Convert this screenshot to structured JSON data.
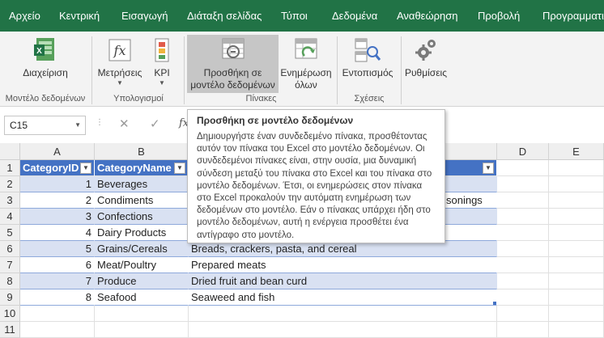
{
  "tabs": [
    "Αρχείο",
    "Κεντρική",
    "Εισαγωγή",
    "Διάταξη σελίδας",
    "Τύποι",
    "Δεδομένα",
    "Αναθεώρηση",
    "Προβολή",
    "Προγραμματισ"
  ],
  "ribbon": {
    "manage_label": "Διαχείριση",
    "measures_label": "Μετρήσεις",
    "kpi_label": "KPI",
    "add_line1": "Προσθήκη σε",
    "add_line2": "μοντέλο δεδομένων",
    "update_line1": "Ενημέρωση",
    "update_line2": "όλων",
    "detect_label": "Εντοπισμός",
    "settings_label": "Ρυθμίσεις",
    "group_model": "Μοντέλο δεδομένων",
    "group_calc": "Υπολογισμοί",
    "group_tables": "Πίνακες",
    "group_relations": "Σχέσεις"
  },
  "formula_bar": {
    "name_box": "C15",
    "fx": "fx"
  },
  "grid": {
    "columns": [
      "A",
      "B",
      "C",
      "D",
      "E"
    ],
    "rows": [
      "1",
      "2",
      "3",
      "4",
      "5",
      "6",
      "7",
      "8",
      "9",
      "10",
      "11"
    ],
    "headers": [
      "CategoryID",
      "CategoryName",
      "Description"
    ],
    "data": [
      {
        "id": "1",
        "name": "Beverages",
        "desc": ""
      },
      {
        "id": "2",
        "name": "Condiments",
        "desc": "",
        "overflow": "sonings"
      },
      {
        "id": "3",
        "name": "Confections",
        "desc": ""
      },
      {
        "id": "4",
        "name": "Dairy Products",
        "desc": ""
      },
      {
        "id": "5",
        "name": "Grains/Cereals",
        "desc": "Breads, crackers, pasta, and cereal"
      },
      {
        "id": "6",
        "name": "Meat/Poultry",
        "desc": "Prepared meats"
      },
      {
        "id": "7",
        "name": "Produce",
        "desc": "Dried fruit and bean curd"
      },
      {
        "id": "8",
        "name": "Seafood",
        "desc": "Seaweed and fish"
      }
    ]
  },
  "tooltip": {
    "title": "Προσθήκη σε μοντέλο δεδομένων",
    "body": "Δημιουργήστε έναν συνδεδεμένο πίνακα, προσθέτοντας αυτόν τον πίνακα του Excel στο μοντέλο δεδομένων. Οι συνδεδεμένοι πίνακες είναι, στην ουσία, μια δυναμική σύνδεση μεταξύ του πίνακα στο Excel και του πίνακα στο μοντέλο δεδομένων. Έτσι, οι ενημερώσεις στον πίνακα στο Excel προκαλούν την αυτόματη ενημέρωση των δεδομένων στο μοντέλο. Εάν ο πίνακας υπάρχει ήδη στο μοντέλο δεδομένων, αυτή η ενέργεια προσθέτει ένα αντίγραφο στο μοντέλο."
  },
  "colors": {
    "tab_bar": "#217346",
    "table_header": "#4472c4",
    "band_row": "#d9e1f2"
  }
}
